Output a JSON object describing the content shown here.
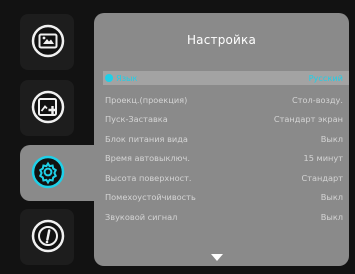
{
  "rail": {
    "items": [
      {
        "name": "display-icon",
        "selected": false
      },
      {
        "name": "image-add-icon",
        "selected": false
      },
      {
        "name": "settings-icon",
        "selected": true
      },
      {
        "name": "info-icon",
        "selected": false
      }
    ]
  },
  "panel": {
    "title": "Настройка",
    "rows": [
      {
        "label": "Язык",
        "value": "Русский",
        "active": true
      },
      {
        "label": "Проекц.(проекция)",
        "value": "Стол-возду.",
        "active": false
      },
      {
        "label": "Пуск-Заставка",
        "value": "Стандарт экран",
        "active": false
      },
      {
        "label": "Блок питания вида",
        "value": "Выкл",
        "active": false
      },
      {
        "label": "Время автовыключ.",
        "value": "15 минут",
        "active": false
      },
      {
        "label": "Высота поверхност.",
        "value": "Стандарт",
        "active": false
      },
      {
        "label": "Помехоустойчивость",
        "value": "Выкл",
        "active": false
      },
      {
        "label": "Звуковой сигнал",
        "value": "Выкл",
        "active": false
      }
    ]
  },
  "colors": {
    "background": "#121212",
    "panel": "#8a8a8a",
    "accent": "#1fd0e8"
  }
}
